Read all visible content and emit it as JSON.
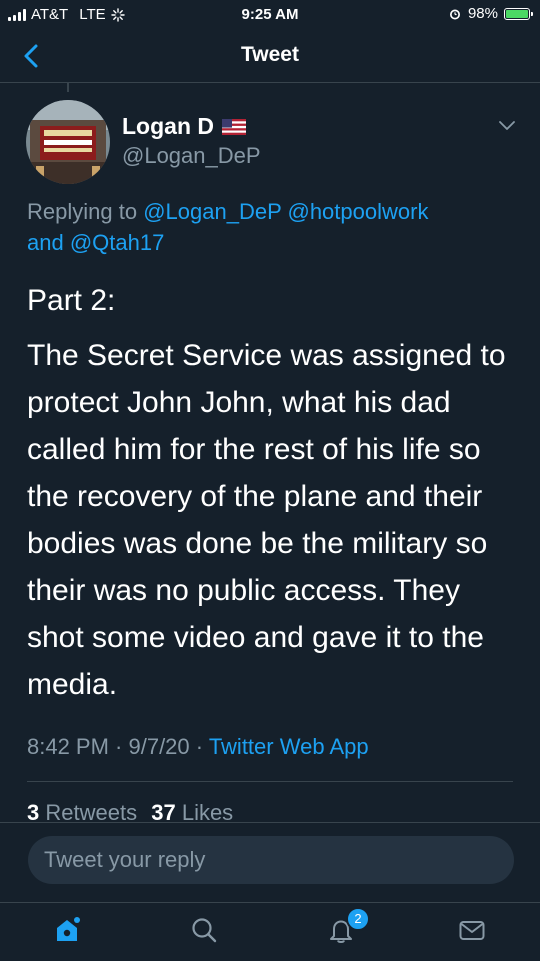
{
  "status_bar": {
    "carrier": "AT&T",
    "network": "LTE",
    "time": "9:25 AM",
    "battery": "98%",
    "battery_level": 0.98
  },
  "nav": {
    "title": "Tweet"
  },
  "tweet": {
    "author_name": "Logan D",
    "author_handle": "@Logan_DeP",
    "replying_prefix": "Replying to",
    "replying_to": [
      "@Logan_DeP",
      "@hotpoolwork",
      "@Qtah17"
    ],
    "replying_and": "and",
    "part_label": "Part 2:",
    "text": "The Secret Service was assigned to protect John John, what his dad called him for the rest of his life so the recovery of the plane and their bodies was done be the military so their was no public access. They shot some video and gave it to the media.",
    "timestamp": "8:42 PM · 9/7/20 · ",
    "source": "Twitter Web App",
    "retweets_count": "3",
    "retweets_label": "Retweets",
    "likes_count": "37",
    "likes_label": "Likes"
  },
  "reply": {
    "placeholder": "Tweet your reply"
  },
  "tabs": {
    "notifications_badge": "2"
  },
  "colors": {
    "background": "#15202b",
    "accent": "#1da1f2",
    "secondary_text": "#8899a6",
    "divider": "#38444d"
  }
}
